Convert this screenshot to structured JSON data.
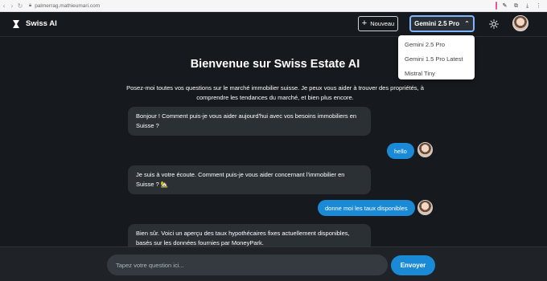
{
  "browser": {
    "url": "palmerrag.mathieumari.com",
    "icons": [
      "back-icon",
      "forward-icon",
      "reload-icon",
      "lock-icon",
      "pen-icon",
      "extensions-icon",
      "download-icon",
      "menu-icon"
    ]
  },
  "header": {
    "app_name": "Swiss AI",
    "new_button": "Nouveau",
    "model_selected": "Gemini 2.5 Pro"
  },
  "model_options": [
    "Gemini 2.5 Pro",
    "Gemini 1.5 Pro Latest",
    "Mistral Tiny"
  ],
  "welcome": {
    "title": "Bienvenue sur Swiss Estate AI",
    "subtitle": "Posez-moi toutes vos questions sur le marché immobilier suisse. Je peux vous aider à trouver des propriétés, à comprendre les tendances du marché, et bien plus encore."
  },
  "messages": [
    {
      "role": "bot",
      "text": "Bonjour ! Comment puis-je vous aider aujourd'hui avec vos besoins immobiliers en Suisse ?"
    },
    {
      "role": "user",
      "text": "hello"
    },
    {
      "role": "bot",
      "text": "Je suis à votre écoute. Comment puis-je vous aider concernant l'immobilier en Suisse ? 🏡"
    },
    {
      "role": "user",
      "text": "donne moi les taux disponibles"
    },
    {
      "role": "bot",
      "text": "Bien sûr. Voici un aperçu des taux hypothécaires fixes actuellement disponibles, basés sur les données fournies par MoneyPark."
    }
  ],
  "composer": {
    "placeholder": "Tapez votre question ici...",
    "send_label": "Envoyer"
  },
  "colors": {
    "background": "#16191d",
    "bot_bubble": "#2b3035",
    "accent": "#1b8ad6",
    "model_focus": "#7fb6ff"
  }
}
